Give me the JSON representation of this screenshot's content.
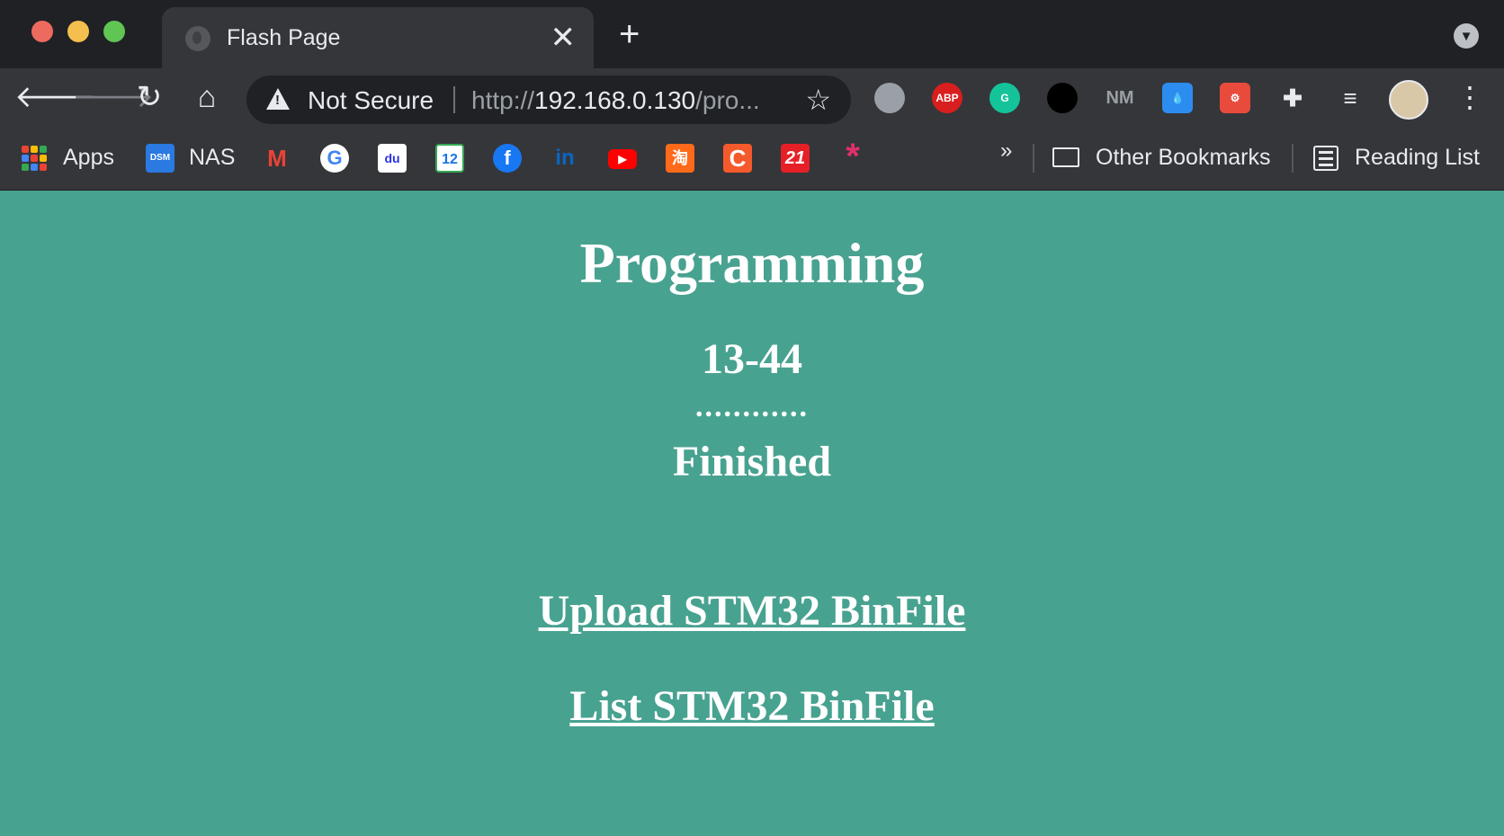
{
  "window": {
    "tab_title": "Flash Page",
    "tab_close": "✕",
    "new_tab": "+"
  },
  "toolbar": {
    "security_label": "Not Secure",
    "url_scheme": "http://",
    "url_host": "192.168.0.130",
    "url_path": "/pro..."
  },
  "extensions": [
    {
      "name": "globe-extension-icon",
      "label": "",
      "color": "#9aa0a6"
    },
    {
      "name": "adblock-plus-icon",
      "label": "ABP",
      "color": "#d81e1e"
    },
    {
      "name": "grammarly-icon",
      "label": "G",
      "color": "#15c39a"
    },
    {
      "name": "ninja-extension-icon",
      "label": "",
      "color": "#000000"
    },
    {
      "name": "nm-extension-icon",
      "label": "NM",
      "color": "#7c7f85"
    },
    {
      "name": "raindrop-extension-icon",
      "label": "💧",
      "color": "#2d8cf0"
    },
    {
      "name": "gear-extension-icon",
      "label": "⚙",
      "color": "#e84b3c"
    },
    {
      "name": "extensions-puzzle-icon",
      "label": "✚",
      "color": "#35363a"
    },
    {
      "name": "reading-media-icon",
      "label": "≡",
      "color": "#35363a"
    }
  ],
  "bookmarks": {
    "apps_label": "Apps",
    "nas_label": "NAS",
    "nas_badge": "DSM",
    "calendar_day": "12",
    "baidu_label": "du",
    "taobao_label": "淘",
    "c_label": "C",
    "n21_label": "21",
    "overflow": "»",
    "other_label": "Other Bookmarks",
    "reading_list_label": "Reading List"
  },
  "page": {
    "heading": "Programming",
    "chip_id": "13-44",
    "progress_dots": "............",
    "status": "Finished",
    "upload_link": "Upload STM32 BinFile",
    "list_link": "List STM32 BinFile"
  }
}
